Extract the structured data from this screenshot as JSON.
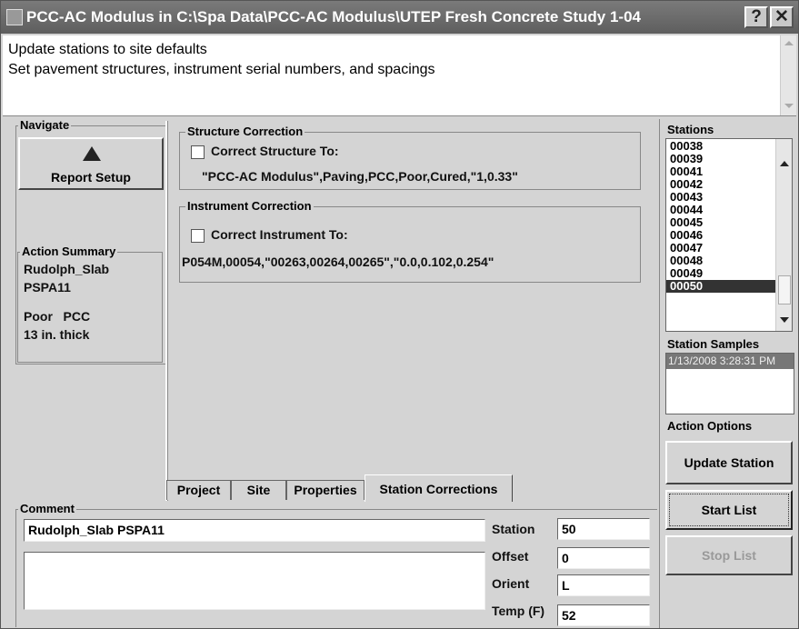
{
  "window": {
    "title": "PCC-AC Modulus in C:\\Spa Data\\PCC-AC Modulus\\UTEP Fresh Concrete Study 1-04",
    "help_label": "?",
    "close_label": "✕"
  },
  "info": {
    "line1": "Update stations to site defaults",
    "line2": "Set pavement structures, instrument serial numbers, and spacings"
  },
  "navigate": {
    "legend": "Navigate",
    "report_setup_label": "Report Setup"
  },
  "action_summary": {
    "legend": "Action Summary",
    "line1": "Rudolph_Slab",
    "line2": "PSPA11",
    "line3": "Poor   PCC",
    "line4": "13 in. thick"
  },
  "structure_correction": {
    "legend": "Structure Correction",
    "checkbox_label": "Correct Structure To:",
    "value": "\"PCC-AC Modulus\",Paving,PCC,Poor,Cured,\"1,0.33\""
  },
  "instrument_correction": {
    "legend": "Instrument Correction",
    "checkbox_label": "Correct Instrument To:",
    "value": "P054M,00054,\"00263,00264,00265\",\"0.0,0.102,0.254\""
  },
  "tabs": [
    {
      "label": "Project"
    },
    {
      "label": "Site"
    },
    {
      "label": "Properties"
    },
    {
      "label": "Station Corrections"
    }
  ],
  "comment": {
    "legend": "Comment",
    "line_value": "Rudolph_Slab PSPA11",
    "notes_value": ""
  },
  "fields": {
    "station_label": "Station",
    "station_value": "50",
    "offset_label": "Offset",
    "offset_value": "0",
    "orient_label": "Orient",
    "orient_value": "L",
    "temp_label": "Temp (F)",
    "temp_value": "52"
  },
  "stations": {
    "legend": "Stations",
    "items": [
      "00038",
      "00039",
      "00041",
      "00042",
      "00043",
      "00044",
      "00045",
      "00046",
      "00047",
      "00048",
      "00049",
      "00050"
    ],
    "selected": "00050"
  },
  "station_samples": {
    "legend": "Station Samples",
    "items": [
      "1/13/2008 3:28:31 PM"
    ]
  },
  "action_options": {
    "legend": "Action Options",
    "update_station_label": "Update Station",
    "start_list_label": "Start List",
    "stop_list_label": "Stop List"
  },
  "colors": {
    "titlebar": "#6a6a6a",
    "panel": "#d4d4d4",
    "selection": "#333333"
  }
}
